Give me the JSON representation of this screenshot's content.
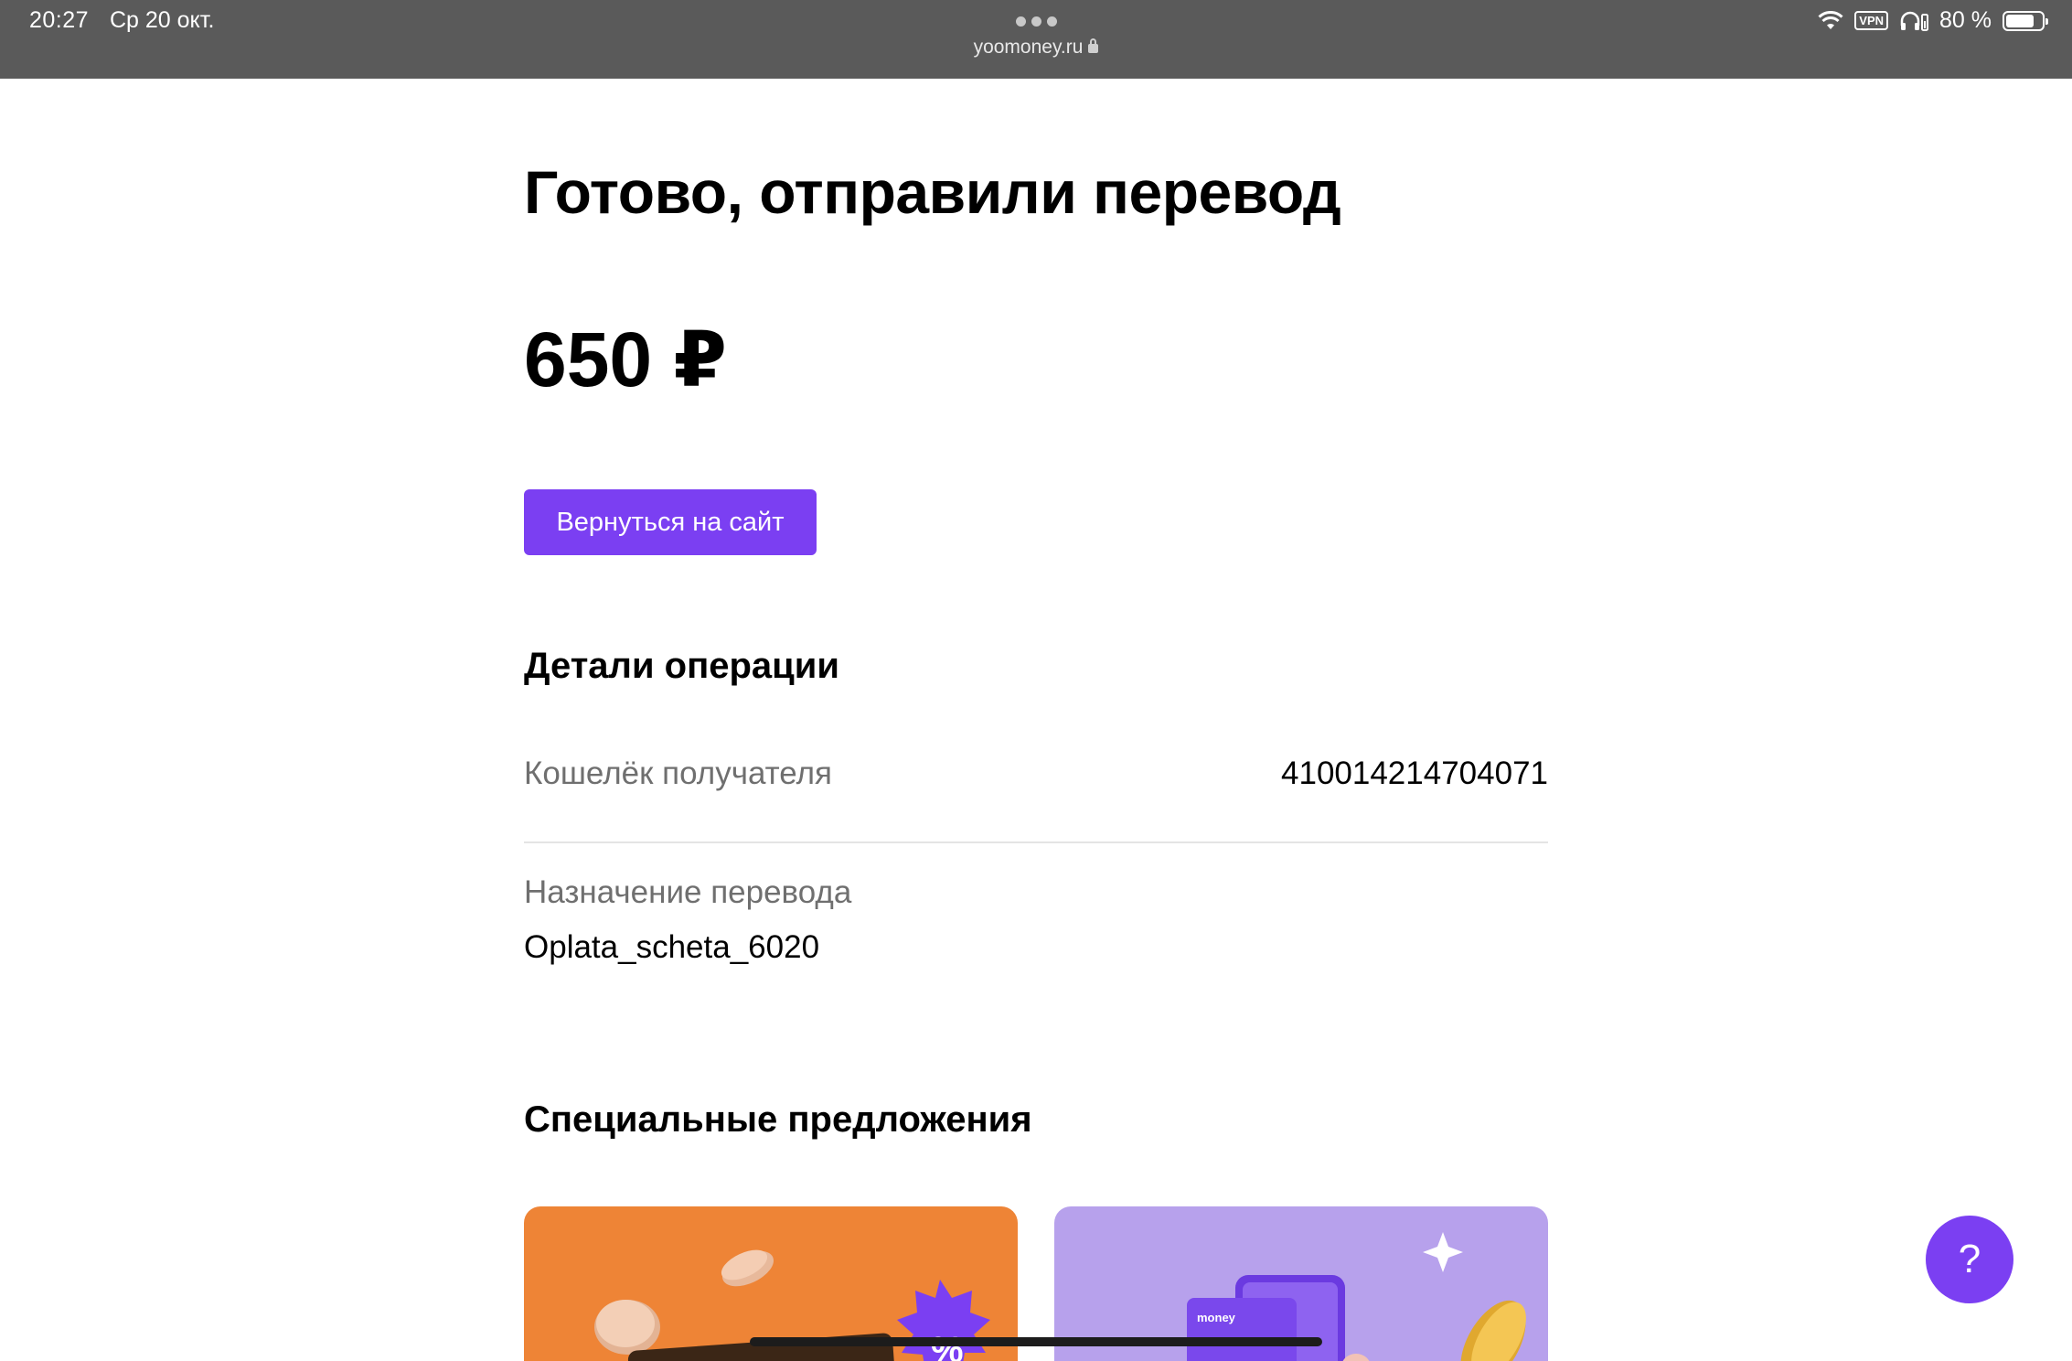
{
  "status_bar": {
    "time": "20:27",
    "date": "Ср 20 окт.",
    "url": "yoomoney.ru",
    "vpn": "VPN",
    "battery_text": "80 %",
    "battery_level": 0.8
  },
  "page": {
    "title": "Готово, отправили перевод",
    "amount": "650 ₽",
    "back_button": "Вернуться на сайт"
  },
  "details": {
    "heading": "Детали операции",
    "wallet_label": "Кошелёк получателя",
    "wallet_value": "410014214704071",
    "purpose_label": "Назначение перевода",
    "purpose_value": "Oplata_scheta_6020"
  },
  "offers": {
    "heading": "Специальные предложения",
    "card_1_color": "#ee8436",
    "card_2_color": "#b7a1ec",
    "card_2_logo": "money"
  },
  "help": {
    "label": "?"
  },
  "colors": {
    "accent": "#7b3ff2",
    "statusbar": "#5a5a5a"
  }
}
